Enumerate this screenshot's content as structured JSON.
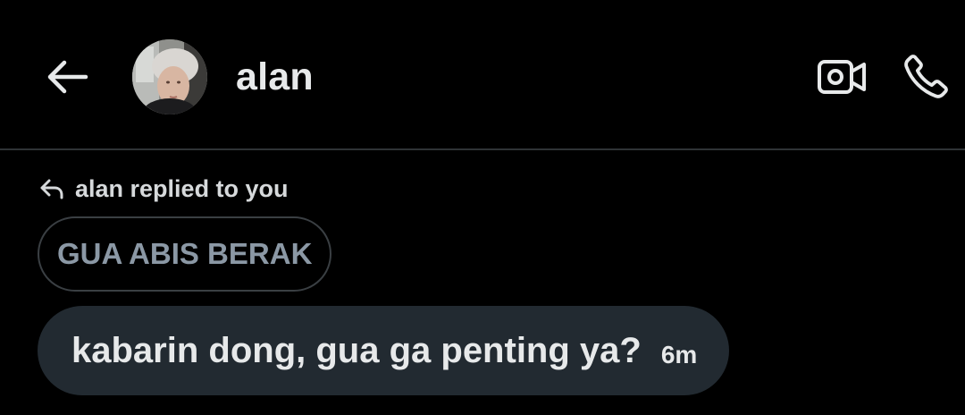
{
  "header": {
    "contact_name": "alan",
    "back_icon": "arrow-left-icon",
    "video_icon": "video-camera-icon",
    "call_icon": "phone-icon"
  },
  "conversation": {
    "reply_context": {
      "icon": "reply-arrow-icon",
      "text": "alan replied to you"
    },
    "quoted_message": "GUA ABIS BERAK",
    "message": {
      "text": "kabarin dong, gua ga penting ya?",
      "time": "6m"
    }
  },
  "colors": {
    "background": "#000000",
    "divider": "#2f3336",
    "bubble": "#222a31",
    "quoted_border": "#3a3f43",
    "quoted_text": "#8b98a5",
    "text": "#e7e9ea"
  }
}
